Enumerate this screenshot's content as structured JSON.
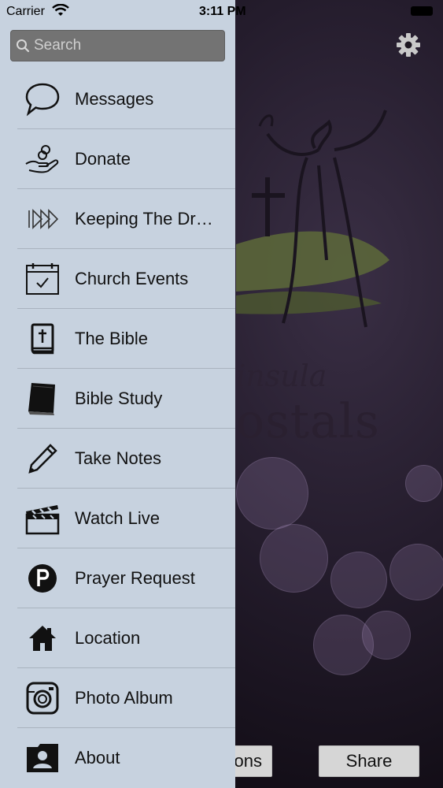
{
  "status_bar": {
    "carrier": "Carrier",
    "time": "3:11 PM"
  },
  "search": {
    "placeholder": "Search",
    "value": ""
  },
  "menu": {
    "items": [
      {
        "label": "Messages",
        "icon": "speech-bubble-icon"
      },
      {
        "label": "Donate",
        "icon": "donate-hand-icon"
      },
      {
        "label": "Keeping The Dr…",
        "icon": "fast-forward-icon"
      },
      {
        "label": "Church Events",
        "icon": "calendar-icon"
      },
      {
        "label": "The Bible",
        "icon": "bible-icon"
      },
      {
        "label": "Bible Study",
        "icon": "book-icon"
      },
      {
        "label": "Take Notes",
        "icon": "pencil-icon"
      },
      {
        "label": "Watch Live",
        "icon": "clapperboard-icon"
      },
      {
        "label": "Prayer Request",
        "icon": "prayer-p-icon"
      },
      {
        "label": "Location",
        "icon": "house-icon"
      },
      {
        "label": "Photo Album",
        "icon": "camera-icon"
      },
      {
        "label": "About",
        "icon": "contact-card-icon"
      }
    ]
  },
  "background": {
    "logo_text_line1": "insula",
    "logo_text_line2": "ostals",
    "buttons": {
      "sessions_label": "ons",
      "share_label": "Share"
    }
  },
  "colors": {
    "drawer_bg": "#c7d2df",
    "search_bg": "#737373",
    "divider": "#a9b3bf",
    "background_dark": "#241c2c"
  }
}
